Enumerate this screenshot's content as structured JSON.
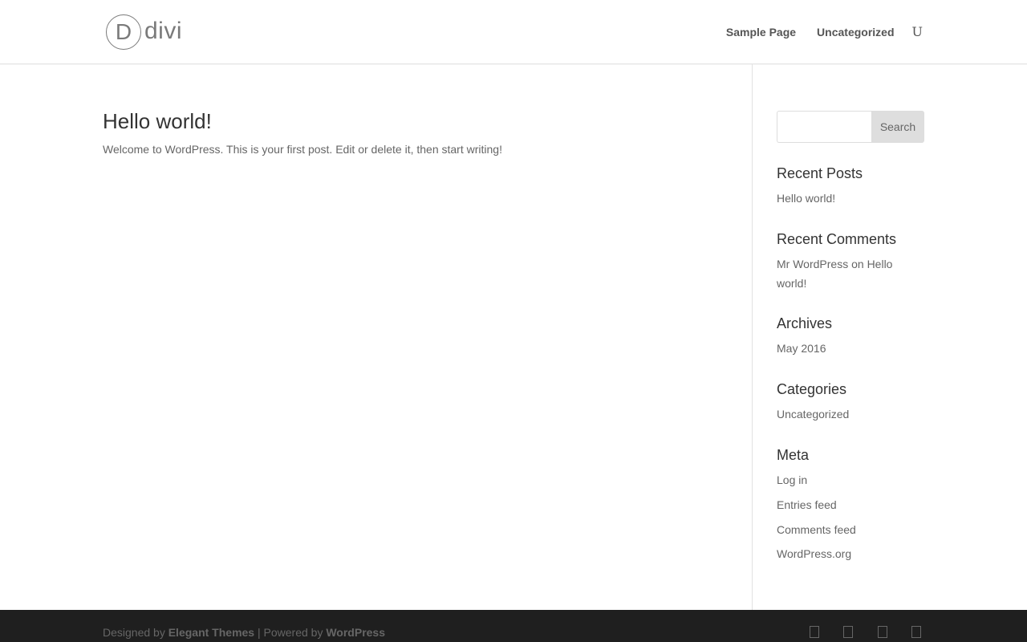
{
  "header": {
    "logo_mark": "D",
    "logo_word": "divi",
    "nav": [
      {
        "label": "Sample Page"
      },
      {
        "label": "Uncategorized"
      }
    ],
    "search_glyph": "U"
  },
  "post": {
    "title": "Hello world!",
    "excerpt": "Welcome to WordPress. This is your first post. Edit or delete it, then start writing!"
  },
  "sidebar": {
    "search": {
      "input_value": "",
      "button_label": "Search"
    },
    "recent_posts": {
      "title": "Recent Posts",
      "items": [
        "Hello world!"
      ]
    },
    "recent_comments": {
      "title": "Recent Comments",
      "author": "Mr WordPress",
      "connector": "on",
      "post": "Hello world!"
    },
    "archives": {
      "title": "Archives",
      "items": [
        "May 2016"
      ]
    },
    "categories": {
      "title": "Categories",
      "items": [
        "Uncategorized"
      ]
    },
    "meta": {
      "title": "Meta",
      "items": [
        "Log in",
        "Entries feed",
        "Comments feed",
        "WordPress.org"
      ]
    }
  },
  "footer": {
    "designed_by_prefix": "Designed by",
    "designer": "Elegant Themes",
    "separator": "| Powered by",
    "platform": "WordPress",
    "social_icons": [
      "facebook-icon",
      "twitter-icon",
      "google-plus-icon",
      "rss-icon"
    ]
  },
  "colors": {
    "footer_bg": "#1f1f1f",
    "text": "#666666",
    "heading": "#333333",
    "search_button_bg": "#dedede"
  }
}
